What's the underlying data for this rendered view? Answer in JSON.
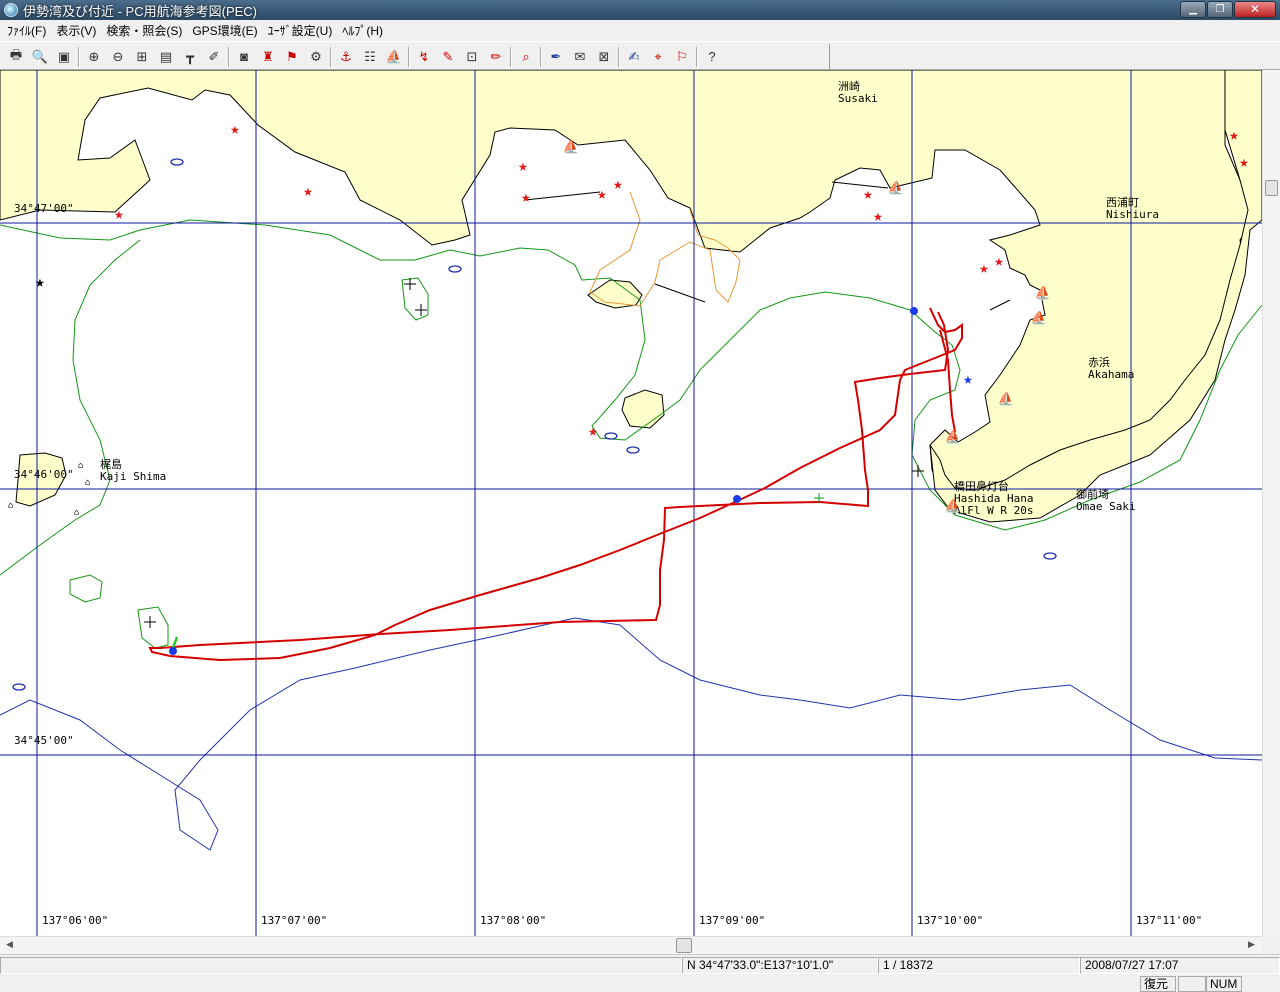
{
  "window": {
    "title": "伊勢湾及び付近 - PC用航海参考図(PEC)"
  },
  "menu": [
    {
      "label": "ﾌｧｲﾙ(F)"
    },
    {
      "label": "表示(V)"
    },
    {
      "label": "検索・照会(S)"
    },
    {
      "label": "GPS環境(E)"
    },
    {
      "label": "ﾕｰｻﾞ設定(U)"
    },
    {
      "label": "ﾍﾙﾌﾟ(H)"
    }
  ],
  "toolbar": {
    "icons": [
      "print-icon",
      "print-preview-icon",
      "save-icon",
      "zoom-in-icon",
      "zoom-out-icon",
      "fit-icon",
      "layers-icon",
      "ruler-icon",
      "compass-icon",
      "binoculars-icon",
      "buoy-icon",
      "light-icon",
      "factory-icon",
      "anchor-icon",
      "table-icon",
      "boat-icon",
      "route-icon",
      "label-icon",
      "frame-icon",
      "pen-icon",
      "search-mark-icon",
      "draw-icon",
      "comment-icon",
      "view-icon",
      "edit-icon",
      "find-icon",
      "flag-icon",
      "help-icon"
    ]
  },
  "map": {
    "lat_labels": [
      "34°47'00\"",
      "34°46'00\"",
      "34°45'00\""
    ],
    "lon_labels": [
      "137°06'00\"",
      "137°07'00\"",
      "137°08'00\"",
      "137°09'00\"",
      "137°10'00\"",
      "137°11'00\""
    ],
    "places": [
      {
        "jp": "洲崎",
        "en": "Susaki"
      },
      {
        "jp": "西浦町",
        "en": "Nishiura"
      },
      {
        "jp": "赤浜",
        "en": "Akahama"
      },
      {
        "jp": "梶島",
        "en": "Kaji Shima"
      },
      {
        "jp": "御前埼",
        "en": "Omae Saki"
      }
    ],
    "lighthouse": {
      "jp": "橋田鼻灯台",
      "en": "Hashida Hana",
      "char": "AlFl W R 20s"
    },
    "colors": {
      "land": "#ffffcc",
      "grid": "#0b1a9c",
      "track": "#d40000",
      "contour": "#159615",
      "contour_brown": "#e39a3a",
      "depth": "#2233aa"
    }
  },
  "status": {
    "position": "N 34°47'33.0\":E137°10'1.0\"",
    "scale": "1 / 18372",
    "datetime": "2008/07/27 17:07",
    "restore": "復元",
    "num": "NUM"
  }
}
